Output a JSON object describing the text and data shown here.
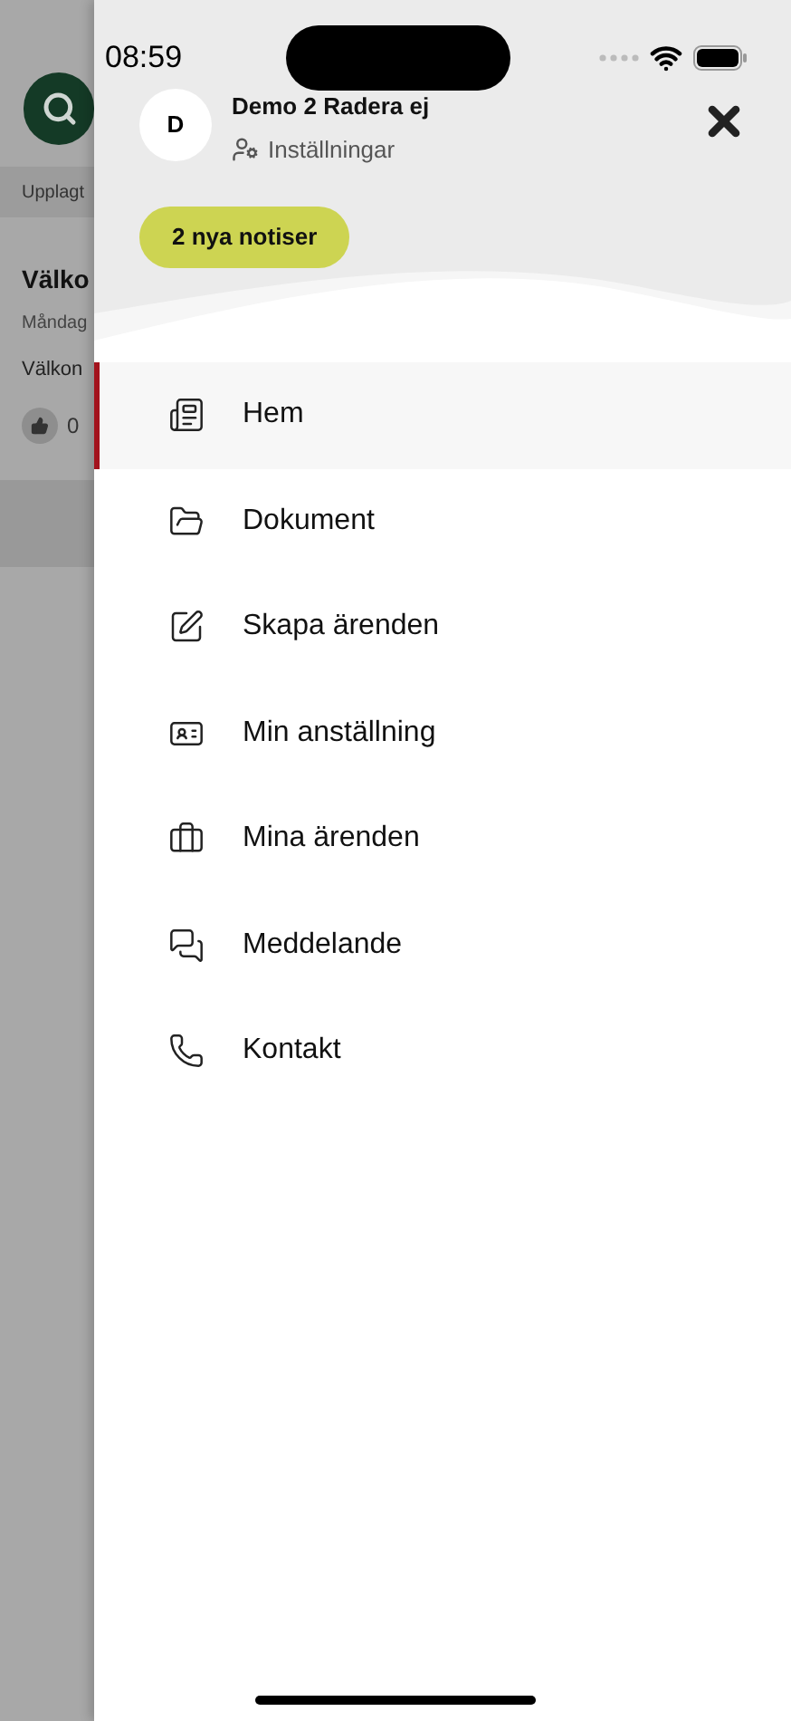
{
  "background_page": {
    "strip_label": "Upplagt",
    "post_title": "Välko",
    "post_date": "Måndag",
    "post_text": "Välkon",
    "likes": "0"
  },
  "status_bar": {
    "time": "08:59"
  },
  "profile": {
    "avatar_letter": "D",
    "name": "Demo 2 Radera ej",
    "settings_link": "Inställningar"
  },
  "notifications_button": "2 nya notiser",
  "menu": [
    {
      "kind": "newspaper",
      "label": "Hem",
      "selected": true
    },
    {
      "kind": "folder",
      "label": "Dokument",
      "selected": false
    },
    {
      "kind": "edit",
      "label": "Skapa ärenden",
      "selected": false
    },
    {
      "kind": "idcard",
      "label": "Min anställning",
      "selected": false
    },
    {
      "kind": "briefcase",
      "label": "Mina ärenden",
      "selected": false
    },
    {
      "kind": "chat",
      "label": "Meddelande",
      "selected": false
    },
    {
      "kind": "phone",
      "label": "Kontakt",
      "selected": false
    }
  ]
}
